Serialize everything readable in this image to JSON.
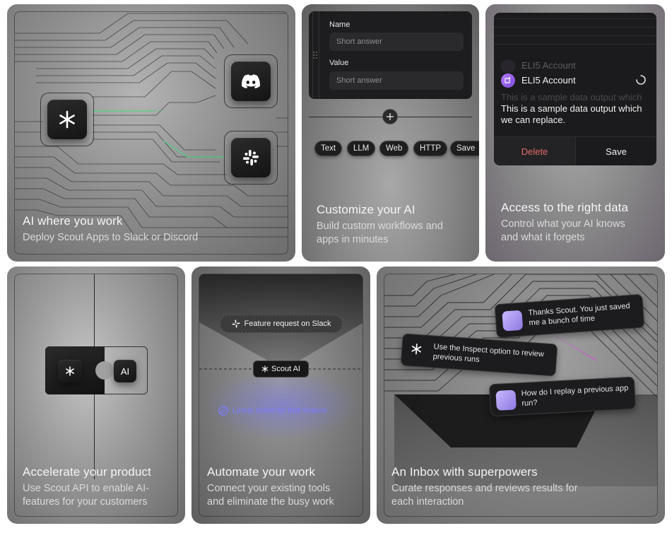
{
  "cards": [
    {
      "title": "AI where you work",
      "desc": "Deploy Scout Apps to Slack or Discord"
    },
    {
      "title": "Customize your AI",
      "desc_line1": "Build custom workflows and",
      "desc_line2": "apps in minutes"
    },
    {
      "title": "Access to the right data",
      "desc_line1": "Control what your AI knows",
      "desc_line2": "and what it forgets"
    },
    {
      "title": "Accelerate your product",
      "desc_line1": "Use Scout API to enable AI-",
      "desc_line2": "features for your customers"
    },
    {
      "title": "Automate your work",
      "desc_line1": "Connect your existing tools",
      "desc_line2": "and eliminate the busy work"
    },
    {
      "title": "An Inbox with superpowers",
      "desc_line1": "Curate responses and reviews results for",
      "desc_line2": "each interaction"
    }
  ],
  "form": {
    "name_label": "Name",
    "name_placeholder": "Short answer",
    "value_label": "Value",
    "value_placeholder": "Short answer"
  },
  "block_chips": [
    "Text",
    "LLM",
    "Web",
    "HTTP",
    "Save"
  ],
  "data_panel": {
    "account_ghost": "ELI5 Account",
    "account": "ELI5 Account",
    "output_ghost": "This is a sample data output which",
    "output": "This is a sample data output which we can replace.",
    "delete_label": "Delete",
    "save_label": "Save"
  },
  "api_panel": {
    "ai_label": "AI"
  },
  "automation": {
    "trigger": "Feature request on Slack",
    "agent": "Scout AI",
    "result": "Linear ticket for that feature"
  },
  "inbox": {
    "msg1": "Thanks Scout. You just saved me a bunch of time",
    "msg2": "Use the Inspect option to review previous runs",
    "msg3": "How do I replay a previous app run?"
  },
  "colors": {
    "connector_green": "#3fdc7a",
    "delete_red": "#e66a6a",
    "linear_purple": "#7b7bff",
    "inbox_pink": "#d24bd8"
  },
  "icons": {
    "scout": "asterisk-icon",
    "discord": "discord-icon",
    "slack": "slack-icon",
    "add": "plus-icon",
    "drag": "drag-handle-icon",
    "loading": "spinner-icon",
    "linear": "linear-icon",
    "account": "account-icon"
  }
}
